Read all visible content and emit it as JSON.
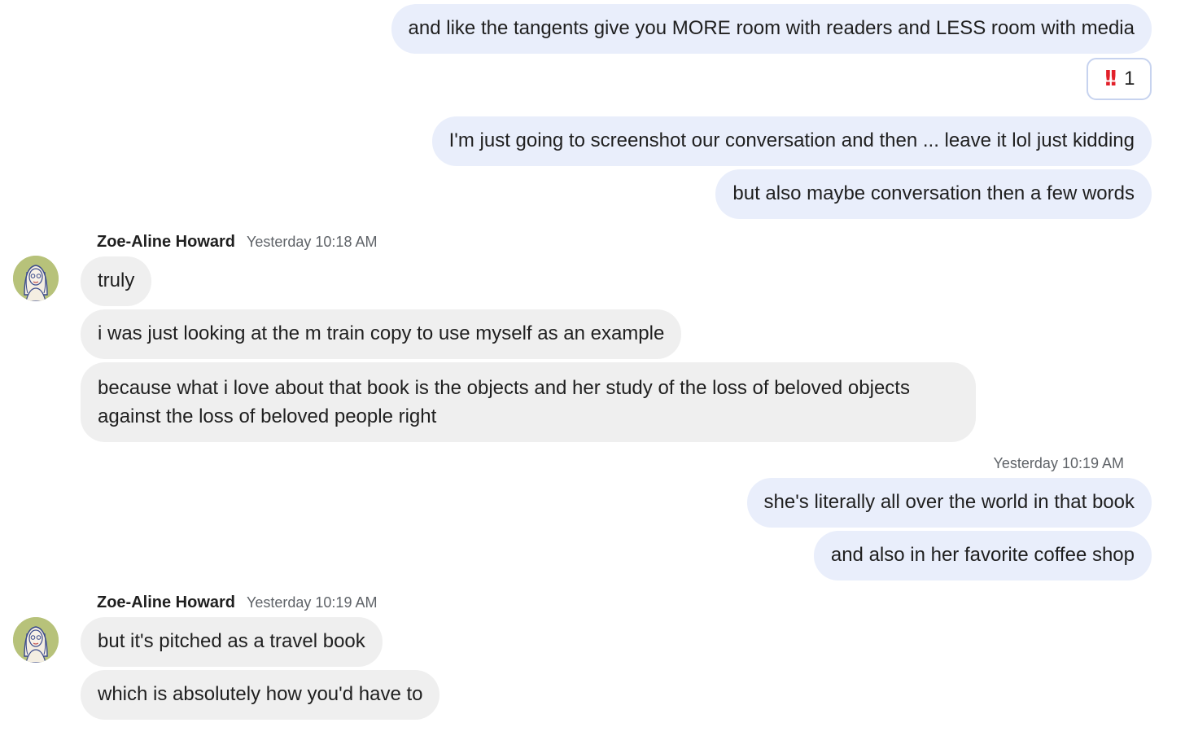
{
  "messages_outgoing_top": [
    {
      "text": "and like the tangents give you MORE room with readers and LESS room with media"
    },
    {
      "text": "I'm just going to screenshot our conversation and then ... leave it lol just kidding"
    },
    {
      "text": "but also maybe conversation then a few words"
    }
  ],
  "reaction": {
    "emoji": "‼️",
    "count": "1"
  },
  "group1": {
    "sender": "Zoe-Aline Howard",
    "timestamp": "Yesterday 10:18 AM",
    "messages": [
      {
        "text": "truly"
      },
      {
        "text": "i was just looking at the m train copy to use myself as an example"
      },
      {
        "text": "because what i love about that book is the objects and her study of the loss of beloved objects against the loss of beloved people right"
      }
    ]
  },
  "outgoing_group2": {
    "timestamp": "Yesterday 10:19 AM",
    "messages": [
      {
        "text": "she's literally all over the world in that book"
      },
      {
        "text": "and also in her favorite coffee shop"
      }
    ]
  },
  "group2": {
    "sender": "Zoe-Aline Howard",
    "timestamp": "Yesterday 10:19 AM",
    "messages": [
      {
        "text": "but it's pitched as a travel book"
      },
      {
        "text": "which is absolutely how you'd have to"
      }
    ]
  },
  "colors": {
    "outgoing_bubble": "#e9eefb",
    "incoming_bubble": "#efefef",
    "reaction_border": "#c7d3ef",
    "avatar_bg": "#b7c27a"
  }
}
